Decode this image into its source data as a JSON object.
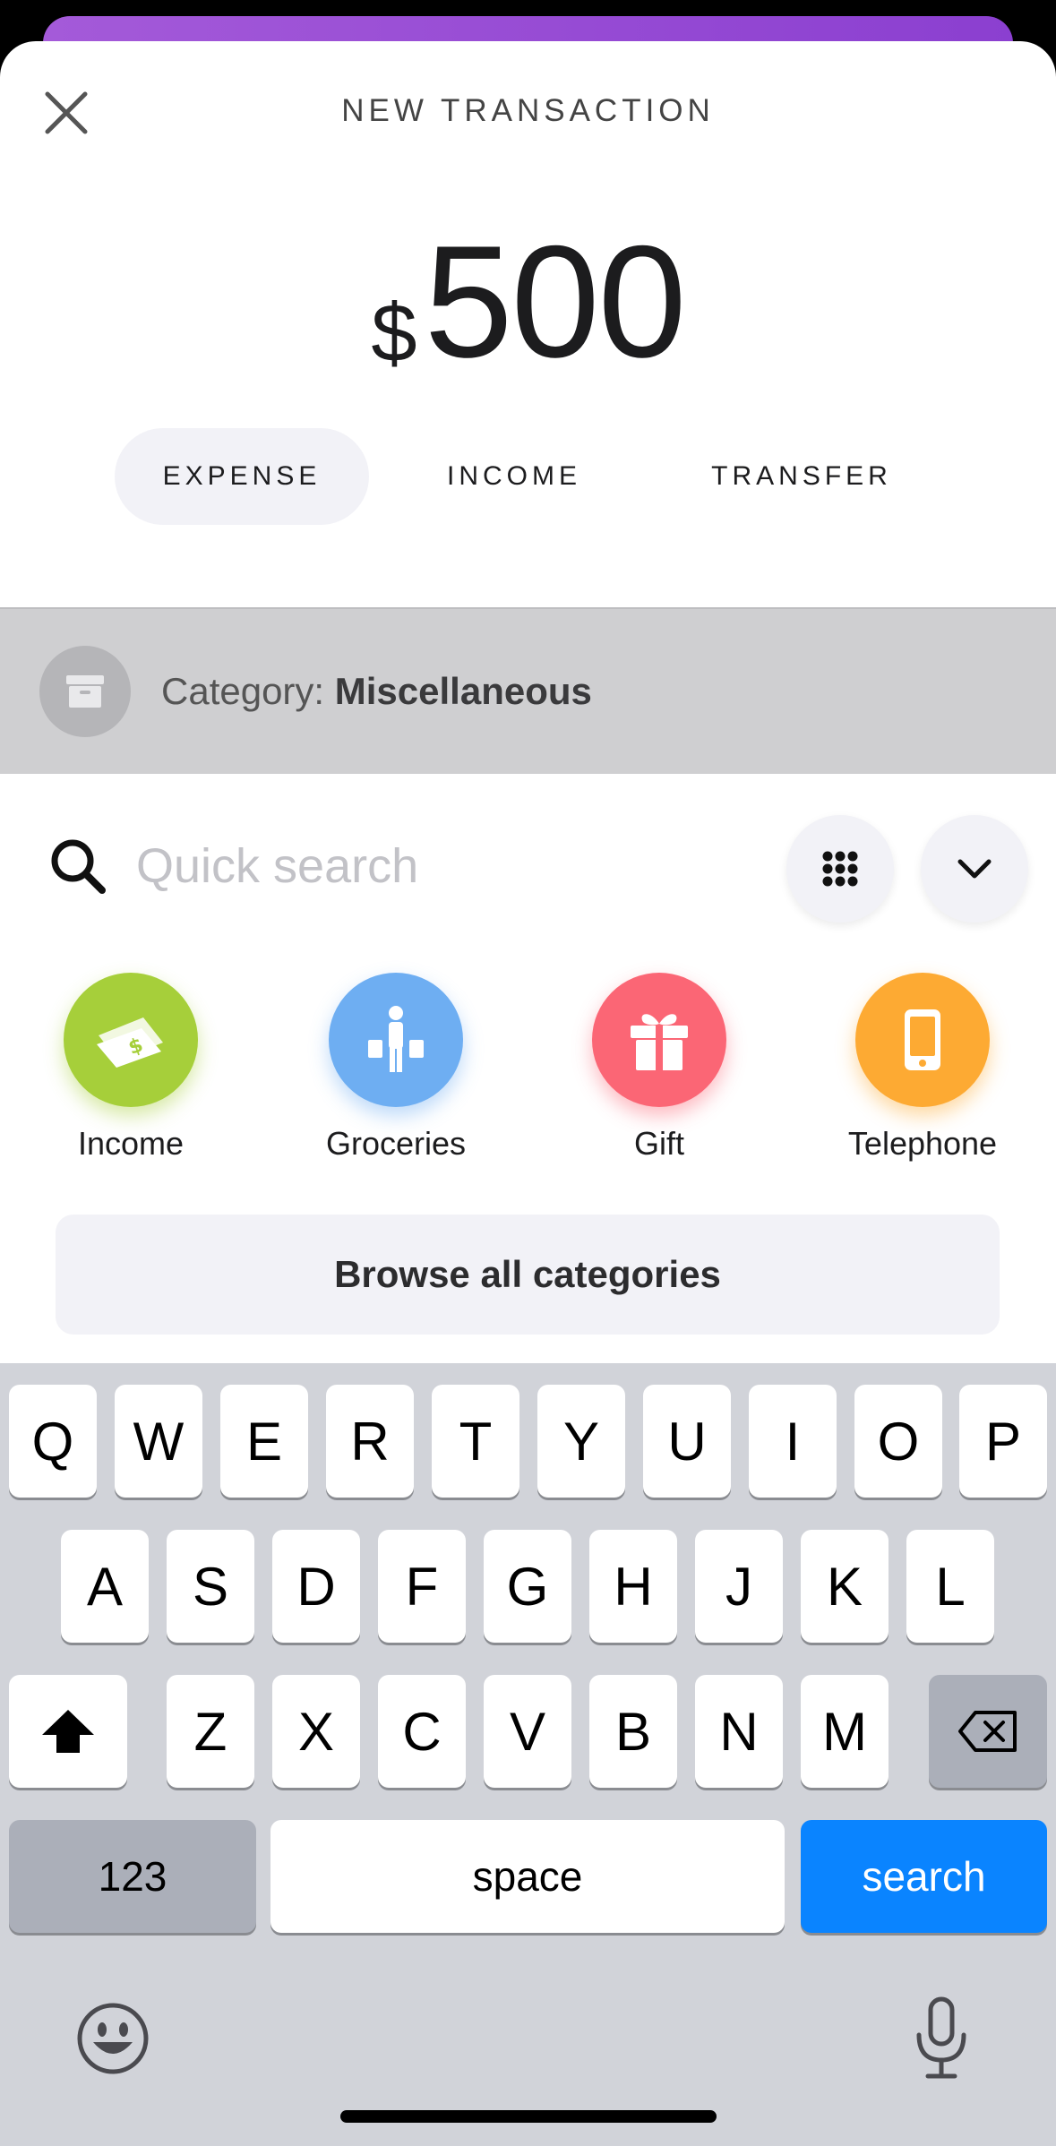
{
  "header": {
    "title": "NEW TRANSACTION"
  },
  "amount": {
    "currency": "$",
    "value": "500"
  },
  "type_tabs": [
    {
      "label": "EXPENSE",
      "active": true
    },
    {
      "label": "INCOME",
      "active": false
    },
    {
      "label": "TRANSFER",
      "active": false
    }
  ],
  "category": {
    "prefix": "Category:",
    "name": "Miscellaneous"
  },
  "search": {
    "placeholder": "Quick search",
    "value": ""
  },
  "quick_categories": [
    {
      "label": "Income",
      "icon": "money-icon",
      "color": "#a6cf3a"
    },
    {
      "label": "Groceries",
      "icon": "shopper-icon",
      "color": "#6eaef2"
    },
    {
      "label": "Gift",
      "icon": "gift-icon",
      "color": "#fb6675"
    },
    {
      "label": "Telephone",
      "icon": "phone-icon",
      "color": "#fdaa33"
    }
  ],
  "browse_label": "Browse all categories",
  "keyboard": {
    "row1": [
      "Q",
      "W",
      "E",
      "R",
      "T",
      "Y",
      "U",
      "I",
      "O",
      "P"
    ],
    "row2": [
      "A",
      "S",
      "D",
      "F",
      "G",
      "H",
      "J",
      "K",
      "L"
    ],
    "row3": [
      "Z",
      "X",
      "C",
      "V",
      "B",
      "N",
      "M"
    ],
    "numbers_label": "123",
    "space_label": "space",
    "action_label": "search"
  },
  "colors": {
    "accent_blue": "#0a84ff",
    "sheet_top": "#9b4fd6"
  }
}
